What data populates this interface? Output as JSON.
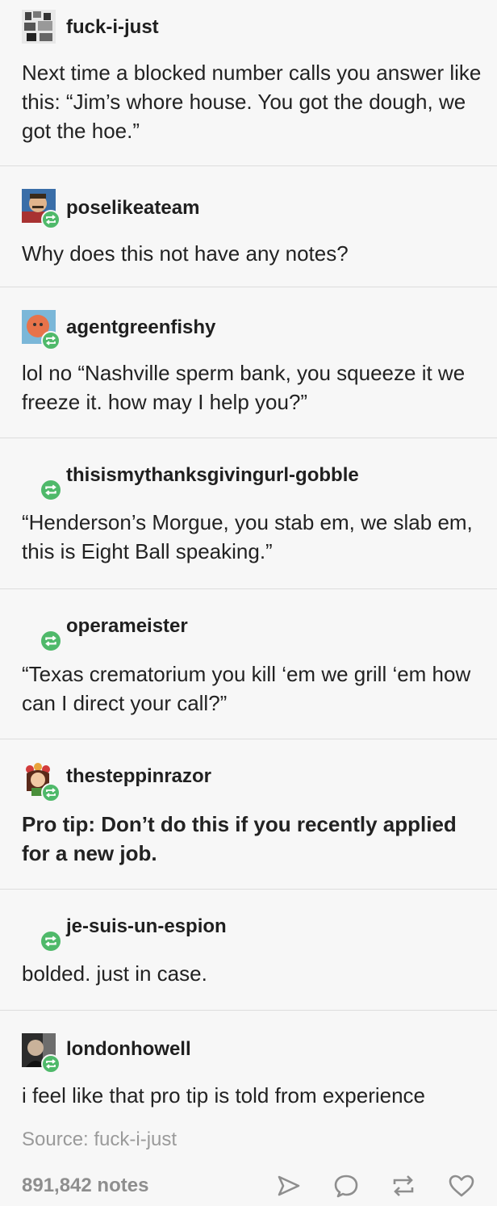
{
  "posts": [
    {
      "username": "fuck-i-just",
      "text": "Next time a blocked number calls you answer like this: “Jim’s whore house. You got the dough, we got the hoe.”",
      "avatar": "pixel-photo"
    },
    {
      "username": "poselikeateam",
      "text": "Why does this not have any notes?",
      "avatar": "man-with-mustache"
    },
    {
      "username": "agentgreenfishy",
      "text": "lol no “Nashville sperm bank, you squeeze it we freeze it. how may I help you?”",
      "avatar": "orange-circle-face"
    },
    {
      "username": "thisismythanksgivingurl-gobble",
      "text": "“Henderson’s Morgue, you stab em, we slab em, this is Eight Ball speaking.”",
      "avatar": "none"
    },
    {
      "username": "operameister",
      "text": "“Texas crematorium you kill ‘em we grill ‘em how can I direct your call?”",
      "avatar": "none"
    },
    {
      "username": "thesteppinrazor",
      "text": "Pro tip: Don’t do this if you recently applied for a new job.",
      "avatar": "cartoon-girl-flower-crown"
    },
    {
      "username": "je-suis-un-espion",
      "text": "bolded. just in case.",
      "avatar": "none"
    },
    {
      "username": "londonhowell",
      "text": "i feel like that pro tip is told from experience",
      "avatar": "dark-portrait"
    }
  ],
  "source_label": "Source: fuck-i-just",
  "notes_count": "891,842 notes",
  "icons": {
    "reblog_badge": "reblog-icon",
    "actions": [
      "share-icon",
      "reply-icon",
      "reblog-icon",
      "heart-icon"
    ]
  },
  "colors": {
    "reblog_green": "#4fb96a",
    "text": "#222222",
    "muted": "#9a9a9a",
    "background": "#f7f7f7"
  }
}
